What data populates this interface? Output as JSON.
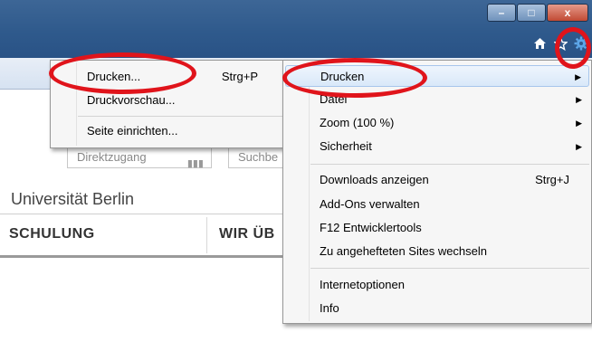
{
  "window": {
    "minimize_label": "–",
    "maximize_label": "□",
    "close_label": "x"
  },
  "toolbar": {
    "icons": [
      "home-icon",
      "favorites-star-icon",
      "gear-icon"
    ]
  },
  "page": {
    "search_quick_placeholder": "Direktzugang",
    "search_placeholder": "Suchbe",
    "university_title": "Universität Berlin",
    "nav_items": [
      "SCHULUNG",
      "WIR ÜB"
    ]
  },
  "print_submenu": {
    "items": [
      {
        "label": "Drucken...",
        "shortcut": "Strg+P"
      },
      {
        "label": "Druckvorschau...",
        "shortcut": ""
      },
      {
        "label": "Seite einrichten...",
        "shortcut": ""
      }
    ]
  },
  "tools_menu": {
    "items": [
      {
        "label": "Drucken",
        "shortcut": "",
        "submenu": true,
        "highlighted": true
      },
      {
        "label": "Datei",
        "shortcut": "",
        "submenu": true
      },
      {
        "label": "Zoom (100 %)",
        "shortcut": "",
        "submenu": true
      },
      {
        "label": "Sicherheit",
        "shortcut": "",
        "submenu": true
      },
      {
        "label": "Downloads anzeigen",
        "shortcut": "Strg+J"
      },
      {
        "label": "Add-Ons verwalten",
        "shortcut": ""
      },
      {
        "label": "F12 Entwicklertools",
        "shortcut": ""
      },
      {
        "label": "Zu angehefteten Sites wechseln",
        "shortcut": ""
      },
      {
        "label": "Internetoptionen",
        "shortcut": ""
      },
      {
        "label": "Info",
        "shortcut": ""
      }
    ]
  },
  "colors": {
    "annotation": "#e0141b",
    "titlebar": "#2f5a8c",
    "gear_icon": "#5da6e8"
  }
}
